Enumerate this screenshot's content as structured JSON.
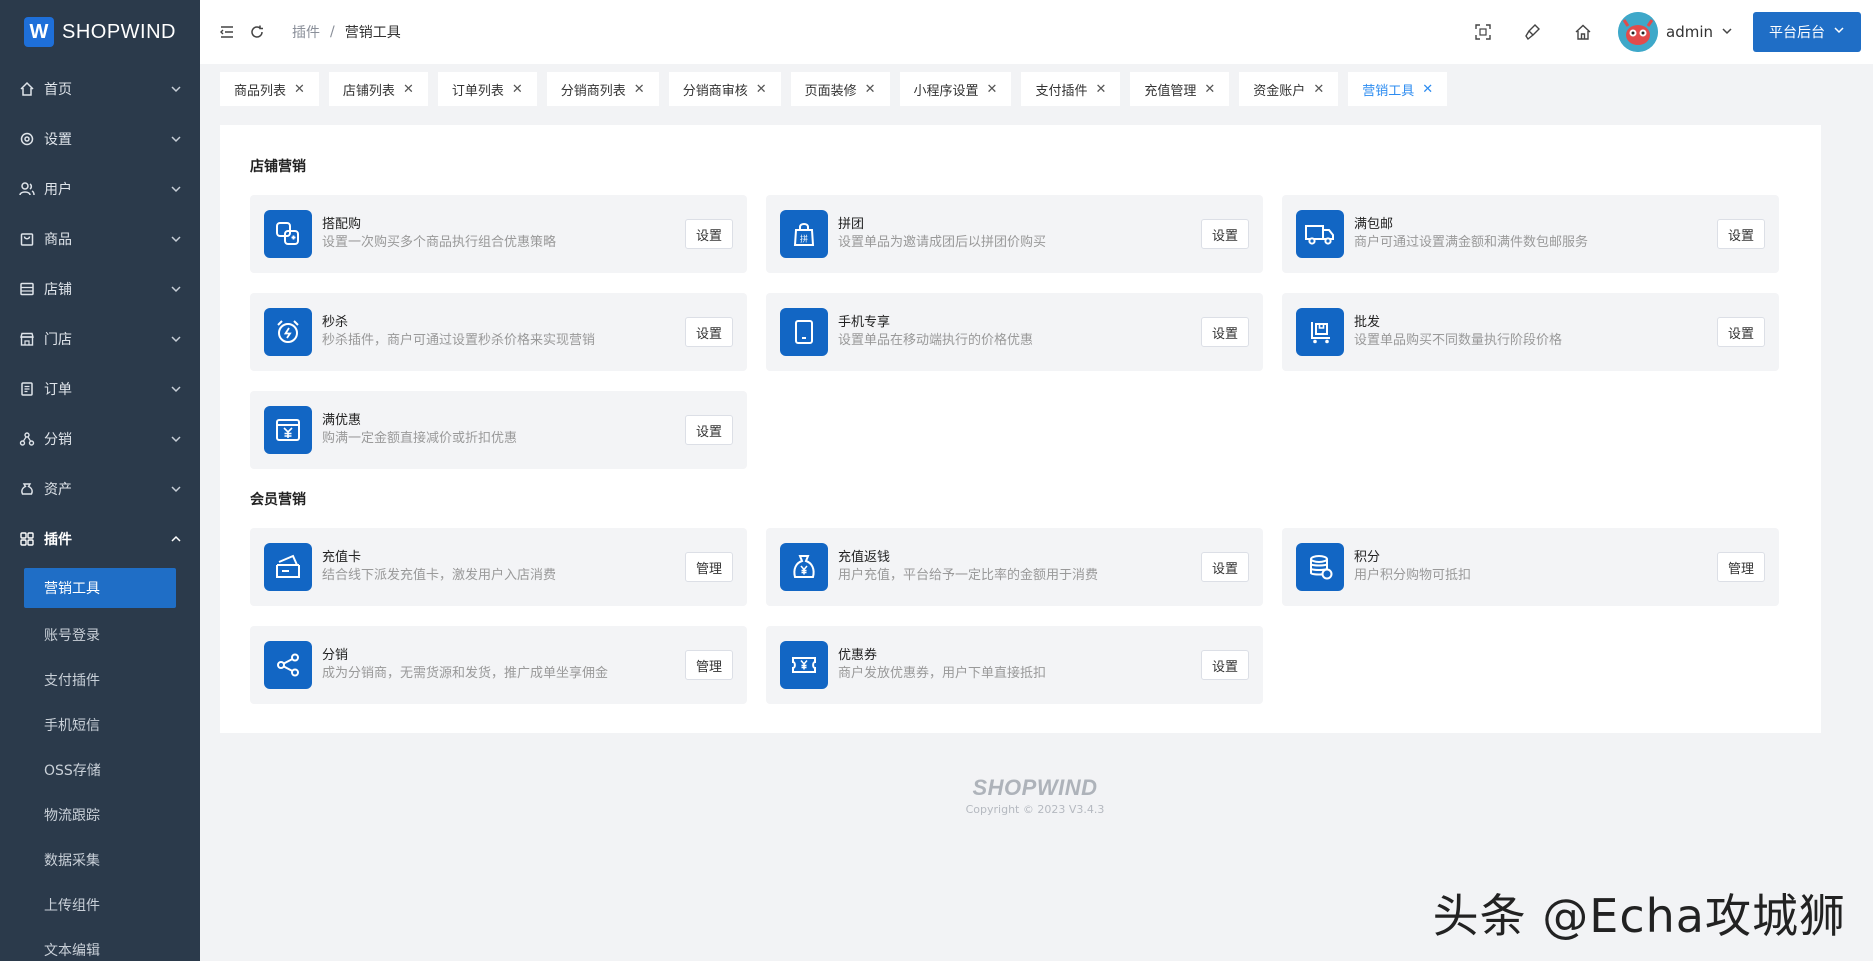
{
  "brand": {
    "mark": "W",
    "name": "SHOPWIND"
  },
  "sidebar": {
    "items": [
      {
        "label": "首页",
        "icon": "home-icon"
      },
      {
        "label": "设置",
        "icon": "gear-icon"
      },
      {
        "label": "用户",
        "icon": "users-icon"
      },
      {
        "label": "商品",
        "icon": "bag-icon"
      },
      {
        "label": "店铺",
        "icon": "store-icon"
      },
      {
        "label": "门店",
        "icon": "shop-icon"
      },
      {
        "label": "订单",
        "icon": "order-icon"
      },
      {
        "label": "分销",
        "icon": "distribution-icon"
      },
      {
        "label": "资产",
        "icon": "wallet-icon"
      },
      {
        "label": "插件",
        "icon": "plugin-icon"
      }
    ],
    "sub_items": [
      "营销工具",
      "账号登录",
      "支付插件",
      "手机短信",
      "OSS存储",
      "物流跟踪",
      "数据采集",
      "上传组件",
      "文本编辑"
    ]
  },
  "topbar": {
    "breadcrumb": [
      "插件",
      "/",
      "营销工具"
    ],
    "user": "admin",
    "platform_button": "平台后台"
  },
  "tabs": [
    "商品列表",
    "店铺列表",
    "订单列表",
    "分销商列表",
    "分销商审核",
    "页面装修",
    "小程序设置",
    "支付插件",
    "充值管理",
    "资金账户",
    "营销工具"
  ],
  "sections": {
    "store_title": "店铺营销",
    "member_title": "会员营销"
  },
  "store_cards": [
    {
      "name": "搭配购",
      "desc": "设置一次购买多个商品执行组合优惠策略",
      "button": "设置",
      "icon": "combo-icon"
    },
    {
      "name": "拼团",
      "desc": "设置单品为邀请成团后以拼团价购买",
      "button": "设置",
      "icon": "group-buy-icon"
    },
    {
      "name": "满包邮",
      "desc": "商户可通过设置满金额和满件数包邮服务",
      "button": "设置",
      "icon": "truck-icon"
    },
    {
      "name": "秒杀",
      "desc": "秒杀插件，商户可通过设置秒杀价格来实现营销",
      "button": "设置",
      "icon": "alarm-icon"
    },
    {
      "name": "手机专享",
      "desc": "设置单品在移动端执行的价格优惠",
      "button": "设置",
      "icon": "phone-icon"
    },
    {
      "name": "批发",
      "desc": "设置单品购买不同数量执行阶段价格",
      "button": "设置",
      "icon": "cart-icon"
    },
    {
      "name": "满优惠",
      "desc": "购满一定金额直接减价或折扣优惠",
      "button": "设置",
      "icon": "yuan-box-icon"
    }
  ],
  "member_cards": [
    {
      "name": "充值卡",
      "desc": "结合线下派发充值卡，激发用户入店消费",
      "button": "管理",
      "icon": "card-icon"
    },
    {
      "name": "充值返钱",
      "desc": "用户充值，平台给予一定比率的金额用于消费",
      "button": "设置",
      "icon": "money-bag-icon"
    },
    {
      "name": "积分",
      "desc": "用户积分购物可抵扣",
      "button": "管理",
      "icon": "coins-icon"
    },
    {
      "name": "分销",
      "desc": "成为分销商，无需货源和发货，推广成单坐享佣金",
      "button": "管理",
      "icon": "share-icon"
    },
    {
      "name": "优惠券",
      "desc": "商户发放优惠券，用户下单直接抵扣",
      "button": "设置",
      "icon": "coupon-icon"
    }
  ],
  "footer": {
    "logo": "SHOPWIND",
    "copyright": "Copyright © 2023 V3.4.3"
  },
  "watermark": "头条 @Echa攻城狮",
  "colors": {
    "primary": "#1f6ec6",
    "sidebar": "#2b3a4b",
    "icon_bg": "#1266c4",
    "tab_active": "#2d8cf0"
  }
}
